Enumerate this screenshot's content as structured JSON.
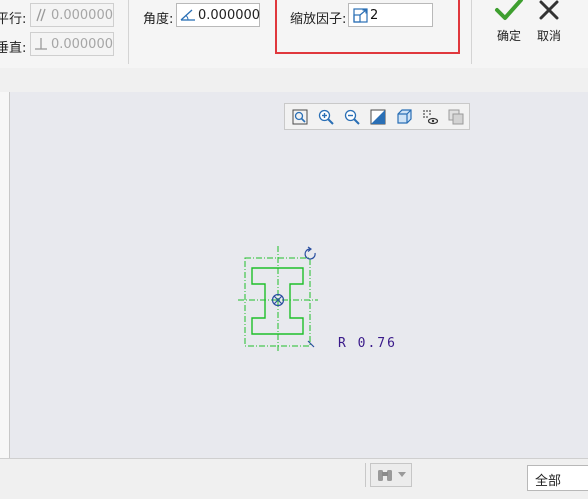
{
  "toolbar": {
    "parallel_label": "平行:",
    "parallel_value": "0.000000",
    "perpendicular_label": "垂直:",
    "perpendicular_value": "0.000000",
    "angle_label": "角度:",
    "angle_value": "0.000000",
    "scale_label": "缩放因子:",
    "scale_value": "2",
    "ok_label": "确定",
    "cancel_label": "取消",
    "ok_color": "#3e9f2f",
    "cancel_color": "#333333",
    "highlight_color": "#e0383d"
  },
  "view_toolbar": {
    "icons": [
      "zoom-to-fit-icon",
      "zoom-in-icon",
      "zoom-out-icon",
      "repaint-icon",
      "saved-views-icon",
      "display-style-icon",
      "sketch-view-icon"
    ]
  },
  "sketch": {
    "radius_dimension": "R 0.76",
    "sketch_color": "#1fbf2a",
    "dimension_color": "#3a1a8a"
  },
  "statusbar": {
    "filter_value": "全部",
    "binoculars_icon": "binoculars-icon"
  }
}
